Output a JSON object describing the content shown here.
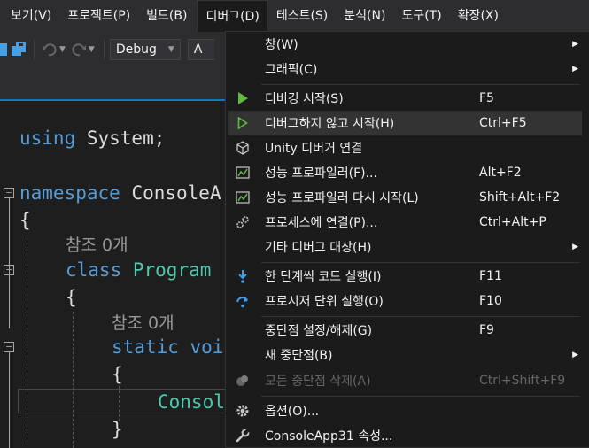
{
  "menubar": {
    "items": [
      {
        "label": "보기(V)"
      },
      {
        "label": "프로젝트(P)"
      },
      {
        "label": "빌드(B)"
      },
      {
        "label": "디버그(D)"
      },
      {
        "label": "테스트(S)"
      },
      {
        "label": "분석(N)"
      },
      {
        "label": "도구(T)"
      },
      {
        "label": "확장(X)"
      }
    ]
  },
  "toolbar": {
    "config": "Debug",
    "platform_partial": "A"
  },
  "editor": {
    "lines": {
      "using_kw": "using",
      "using_rest": " System;",
      "ns_kw": "namespace",
      "ns_name": " ConsoleA",
      "brace1": "{",
      "lens1": "참조 0개",
      "class_kw": "class",
      "class_name": " Program",
      "brace2": "{",
      "lens2": "참조 0개",
      "static_kw": "static",
      "void_partial": " voi",
      "brace3": "{",
      "console_partial": "Consol",
      "brace4": "}"
    }
  },
  "debug_menu": {
    "items": [
      {
        "label": "창(W)",
        "shortcut": ""
      },
      {
        "label": "그래픽(C)",
        "shortcut": ""
      },
      {
        "label": "디버깅 시작(S)",
        "shortcut": "F5"
      },
      {
        "label": "디버그하지 않고 시작(H)",
        "shortcut": "Ctrl+F5"
      },
      {
        "label": "Unity 디버거 연결",
        "shortcut": ""
      },
      {
        "label": "성능 프로파일러(F)...",
        "shortcut": "Alt+F2"
      },
      {
        "label": "성능 프로파일러 다시 시작(L)",
        "shortcut": "Shift+Alt+F2"
      },
      {
        "label": "프로세스에 연결(P)...",
        "shortcut": "Ctrl+Alt+P"
      },
      {
        "label": "기타 디버그 대상(H)",
        "shortcut": ""
      },
      {
        "label": "한 단계씩 코드 실행(I)",
        "shortcut": "F11"
      },
      {
        "label": "프로시저 단위 실행(O)",
        "shortcut": "F10"
      },
      {
        "label": "중단점 설정/해제(G)",
        "shortcut": "F9"
      },
      {
        "label": "새 중단점(B)",
        "shortcut": ""
      },
      {
        "label": "모든 중단점 삭제(A)",
        "shortcut": "Ctrl+Shift+F9"
      },
      {
        "label": "옵션(O)...",
        "shortcut": ""
      },
      {
        "label": "ConsoleApp31 속성...",
        "shortcut": ""
      }
    ]
  },
  "colors": {
    "accent": "#007acc",
    "play_green": "#5fba40",
    "keyword": "#569cd6",
    "type": "#4ec9b0"
  }
}
